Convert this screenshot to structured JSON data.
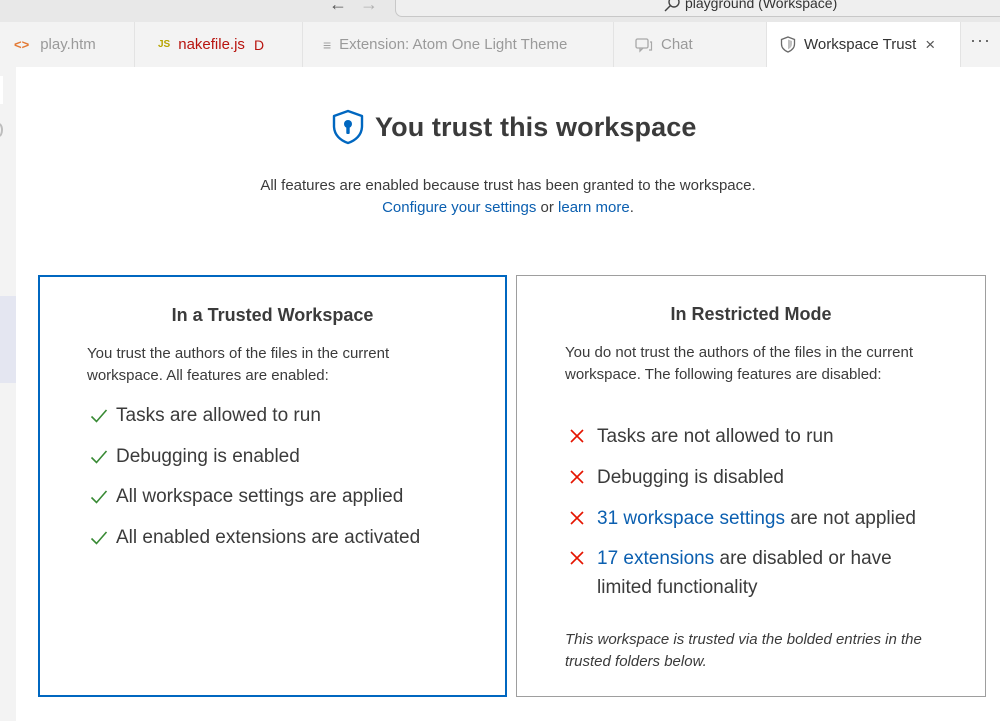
{
  "titlebar": {
    "back_glyph": "←",
    "forward_glyph": "→",
    "search_label": "playground (Workspace)"
  },
  "tabs": [
    {
      "label": "play.htm",
      "icon": "html-icon",
      "icon_glyph": "<>",
      "status": ""
    },
    {
      "label": "nakefile.js",
      "icon": "js-icon",
      "icon_glyph": "JS",
      "status": "D"
    },
    {
      "label": "Extension: Atom One Light Theme",
      "icon": "extension-doc-icon",
      "icon_glyph": "≡",
      "status": ""
    },
    {
      "label": "Chat",
      "icon": "chat-icon",
      "icon_glyph": "",
      "status": ""
    },
    {
      "label": "Workspace Trust",
      "icon": "shield-icon",
      "icon_glyph": "",
      "status": "",
      "close_glyph": "×"
    }
  ],
  "more_actions_glyph": "···",
  "main": {
    "title": "You trust this workspace",
    "subtitle": "All features are enabled because trust has been granted to the workspace.",
    "configure_link": "Configure your settings",
    "or_text": " or ",
    "learn_link": "learn more",
    "period": "."
  },
  "trusted_card": {
    "title": "In a Trusted Workspace",
    "description": "You trust the authors of the files in the current workspace. All features are enabled:",
    "features": [
      "Tasks are allowed to run",
      "Debugging is enabled",
      "All workspace settings are applied",
      "All enabled extensions are activated"
    ]
  },
  "restricted_card": {
    "title": "In Restricted Mode",
    "description": "You do not trust the authors of the files in the current workspace. The following features are disabled:",
    "features": [
      {
        "link": "",
        "text": "Tasks are not allowed to run"
      },
      {
        "link": "",
        "text": "Debugging is disabled"
      },
      {
        "link": "31 workspace settings",
        "text": " are not applied"
      },
      {
        "link": "17 extensions",
        "text": " are disabled or have limited functionality"
      }
    ],
    "note": "This workspace is trusted via the bolded entries in the trusted folders below."
  },
  "colors": {
    "accent_blue": "#0067c0",
    "link_blue": "#0b5fb0",
    "check_green": "#388a34",
    "x_red": "#e51400",
    "dirty_tab_red": "#b8140f"
  }
}
